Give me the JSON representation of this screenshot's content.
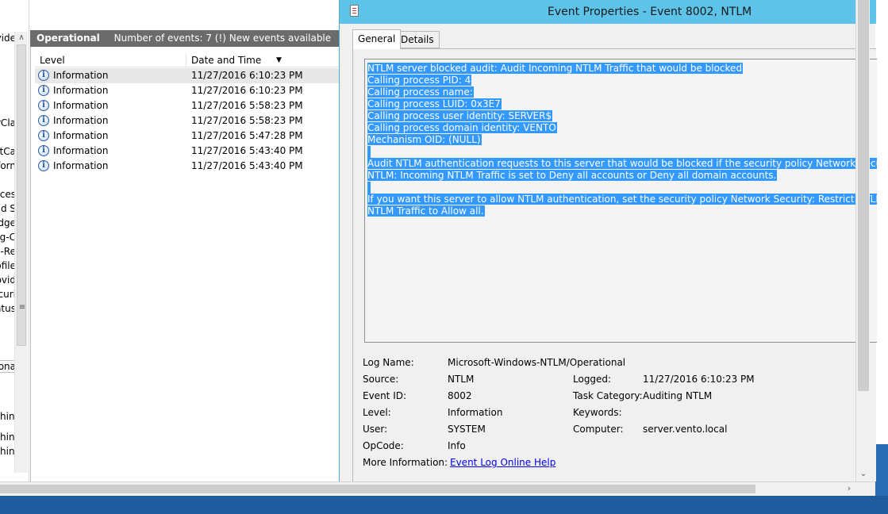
{
  "left_tree": {
    "fragments": [
      "vide",
      "rCla",
      "etCa",
      "forn",
      "cces",
      "nd S",
      "dge",
      "g-C",
      "g-Re",
      "ofile",
      "ovid",
      "curi",
      "atus",
      "ona",
      "hin",
      "hin",
      "hin"
    ],
    "scroll_grip": "≡"
  },
  "event_list": {
    "log_name": "Operational",
    "count_text": "Number of events: 7 (!) New events available",
    "columns": {
      "level": "Level",
      "date": "Date and Time"
    },
    "sort_glyph": "▼",
    "rows": [
      {
        "level": "Information",
        "date": "11/27/2016 6:10:23 PM"
      },
      {
        "level": "Information",
        "date": "11/27/2016 6:10:23 PM"
      },
      {
        "level": "Information",
        "date": "11/27/2016 5:58:23 PM"
      },
      {
        "level": "Information",
        "date": "11/27/2016 5:58:23 PM"
      },
      {
        "level": "Information",
        "date": "11/27/2016 5:47:28 PM"
      },
      {
        "level": "Information",
        "date": "11/27/2016 5:43:40 PM"
      },
      {
        "level": "Information",
        "date": "11/27/2016 5:43:40 PM"
      }
    ],
    "info_icon_glyph": "i"
  },
  "dialog": {
    "title": "Event Properties - Event 8002, NTLM",
    "tabs": {
      "general": "General",
      "details": "Details"
    },
    "description_lines": [
      "NTLM server blocked audit: Audit Incoming NTLM Traffic that would be blocked",
      "Calling process PID: 4",
      "Calling process name:",
      "Calling process LUID: 0x3E7",
      "Calling process user identity: SERVER$",
      "Calling process domain identity: VENTO",
      "Mechanism OID: (NULL)",
      "",
      "Audit NTLM authentication requests to this server that would be blocked if the security policy Network Security: Restrict",
      "NTLM: Incoming NTLM Traffic is set to Deny all accounts or Deny all domain accounts.",
      "",
      "If you want this server to allow NTLM authentication, set the security policy Network Security: Restrict NTLM: Incoming",
      "NTLM Traffic to Allow all."
    ],
    "props": {
      "log_name_label": "Log Name:",
      "log_name_value": "Microsoft-Windows-NTLM/Operational",
      "source_label": "Source:",
      "source_value": "NTLM",
      "logged_label": "Logged:",
      "logged_value": "11/27/2016 6:10:23 PM",
      "event_id_label": "Event ID:",
      "event_id_value": "8002",
      "task_category_label": "Task Category:",
      "task_category_value": "Auditing NTLM",
      "level_label": "Level:",
      "level_value": "Information",
      "keywords_label": "Keywords:",
      "keywords_value": "",
      "user_label": "User:",
      "user_value": "SYSTEM",
      "computer_label": "Computer:",
      "computer_value": "server.vento.local",
      "opcode_label": "OpCode:",
      "opcode_value": "Info",
      "more_info_label": "More Information:",
      "more_info_link": "Event Log Online Help"
    },
    "scroll_down_glyph": "⌄",
    "hscroll_right_glyph": "›"
  },
  "colors": {
    "titlebar": "#5dc3e8",
    "selection": "#3399ff",
    "list_header": "#6b6b6b",
    "taskbar": "#1f5c9e",
    "link": "#0000ee"
  }
}
